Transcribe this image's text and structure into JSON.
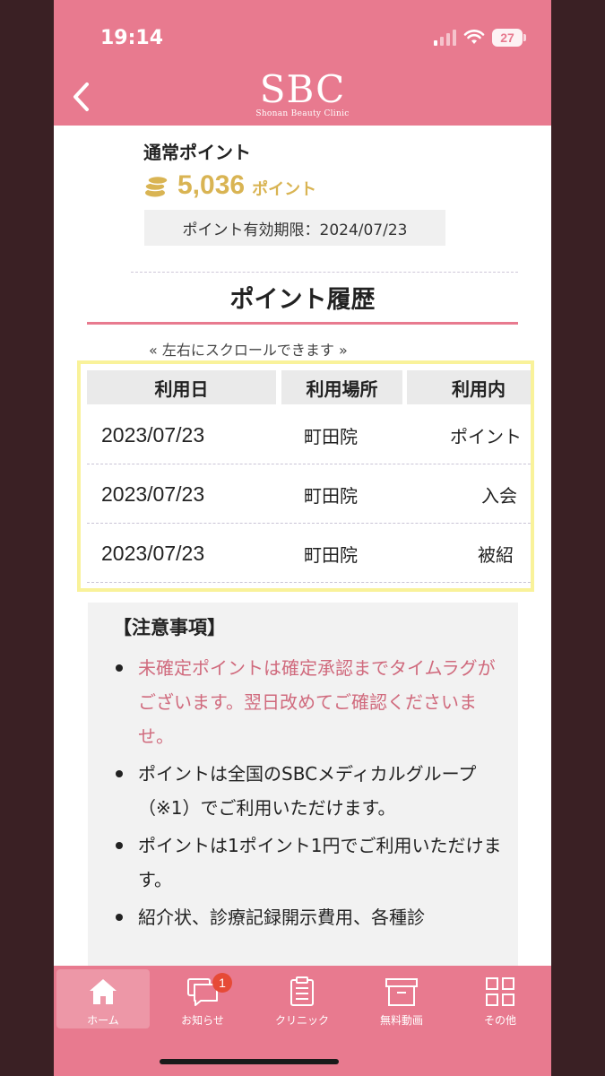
{
  "status_bar": {
    "time": "19:14",
    "battery": "27"
  },
  "header": {
    "logo": "SBC",
    "logo_sub": "Shonan Beauty Clinic"
  },
  "points": {
    "label": "通常ポイント",
    "value": "5,036",
    "unit": "ポイント",
    "expiry": "ポイント有効期限：2024/07/23"
  },
  "history": {
    "title": "ポイント履歴",
    "scroll_hint": "« 左右にスクロールできます »",
    "columns": [
      "利用日",
      "利用場所",
      "利用内"
    ],
    "rows": [
      {
        "date": "2023/07/23",
        "place": "町田院",
        "use": "ポイント"
      },
      {
        "date": "2023/07/23",
        "place": "町田院",
        "use": "入会"
      },
      {
        "date": "2023/07/23",
        "place": "町田院",
        "use": "被紹"
      }
    ]
  },
  "notes": {
    "title": "【注意事項】",
    "items": [
      "未確定ポイントは確定承認までタイムラグがございます。翌日改めてご確認くださいませ。",
      "ポイントは全国のSBCメディカルグループ（※1）でご利用いただけます。",
      "ポイントは1ポイント1円でご利用いただけます。",
      "紹介状、診療記録開示費用、各種診"
    ]
  },
  "tabbar": {
    "items": [
      {
        "label": "ホーム",
        "icon": "home-icon",
        "active": true
      },
      {
        "label": "お知らせ",
        "icon": "chat-icon",
        "badge": "1"
      },
      {
        "label": "クリニック",
        "icon": "clipboard-icon"
      },
      {
        "label": "無料動画",
        "icon": "box-icon"
      },
      {
        "label": "その他",
        "icon": "grid-icon"
      }
    ]
  },
  "colors": {
    "header": "#e87a8f",
    "gold": "#d9b453",
    "highlight": "#f9f29a",
    "note_pink": "#d06a7d"
  }
}
